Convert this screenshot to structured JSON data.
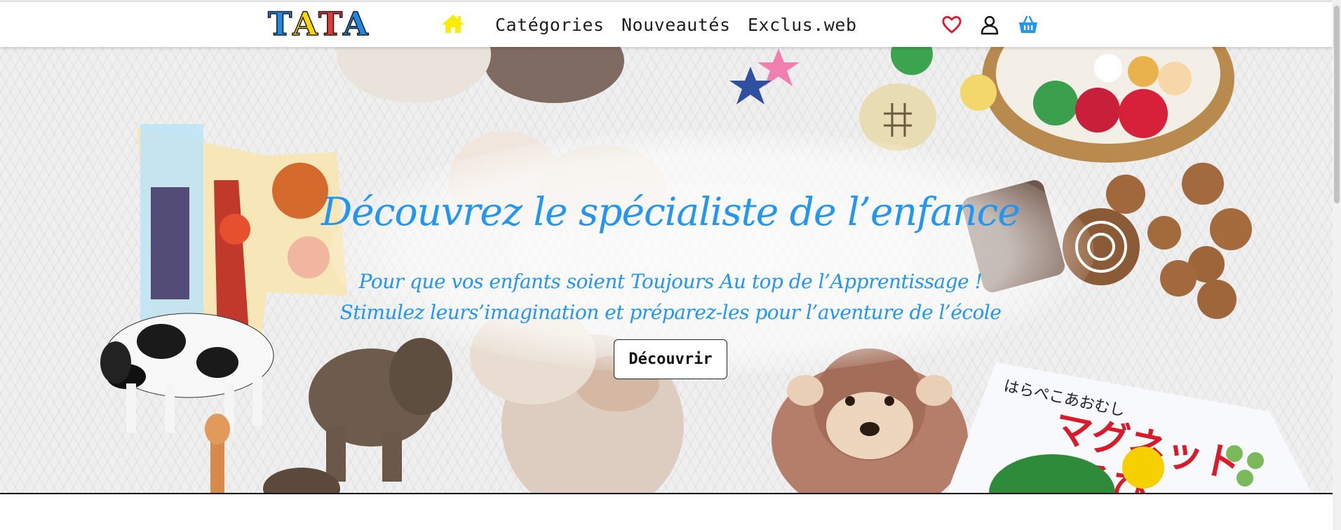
{
  "header": {
    "logo": [
      "T",
      "A",
      "T",
      "A"
    ],
    "logo_colors": [
      "#1e88e5",
      "#ffd600",
      "#e53935",
      "#1e88e5"
    ],
    "nav": {
      "categories": "Catégories",
      "new": "Nouveautés",
      "exclusive": "Exclus.web"
    },
    "icons": {
      "home": "home-icon",
      "wishlist": "heart-icon",
      "account": "user-icon",
      "cart": "basket-icon"
    },
    "colors": {
      "home": "#ffeb00",
      "heart": "#e8102f",
      "user": "#111111",
      "basket": "#2196f3"
    }
  },
  "hero": {
    "title": "Découvrez le spécialiste de l’enfance",
    "subtitle_line1": "Pour que vos enfants soient Toujours Au top de l’Apprentissage !",
    "subtitle_line2": "Stimulez leurs’imagination et préparez-les pour l’aventure de l’école",
    "cta_label": "Découvrir",
    "text_color": "#2196f3"
  }
}
